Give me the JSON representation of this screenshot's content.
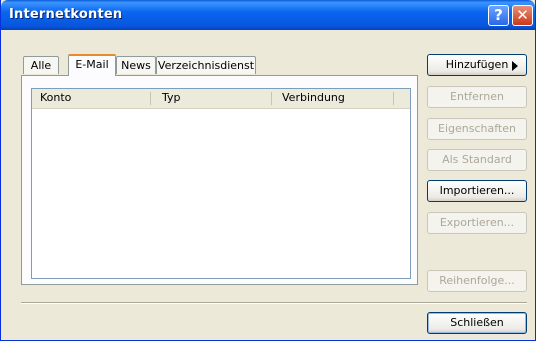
{
  "window": {
    "title": "Internetkonten",
    "help_label": "?",
    "close_label": "✕"
  },
  "tabs": [
    {
      "label": "Alle",
      "active": false
    },
    {
      "label": "E-Mail",
      "active": true
    },
    {
      "label": "News",
      "active": false
    },
    {
      "label": "Verzeichnisdienst",
      "active": false
    }
  ],
  "list": {
    "columns": [
      "Konto",
      "Typ",
      "Verbindung"
    ],
    "rows": []
  },
  "buttons": {
    "add": "Hinzufügen",
    "remove": "Entfernen",
    "properties": "Eigenschaften",
    "set_default": "Als Standard",
    "import": "Importieren...",
    "export": "Exportieren...",
    "order": "Reihenfolge...",
    "close": "Schließen"
  }
}
